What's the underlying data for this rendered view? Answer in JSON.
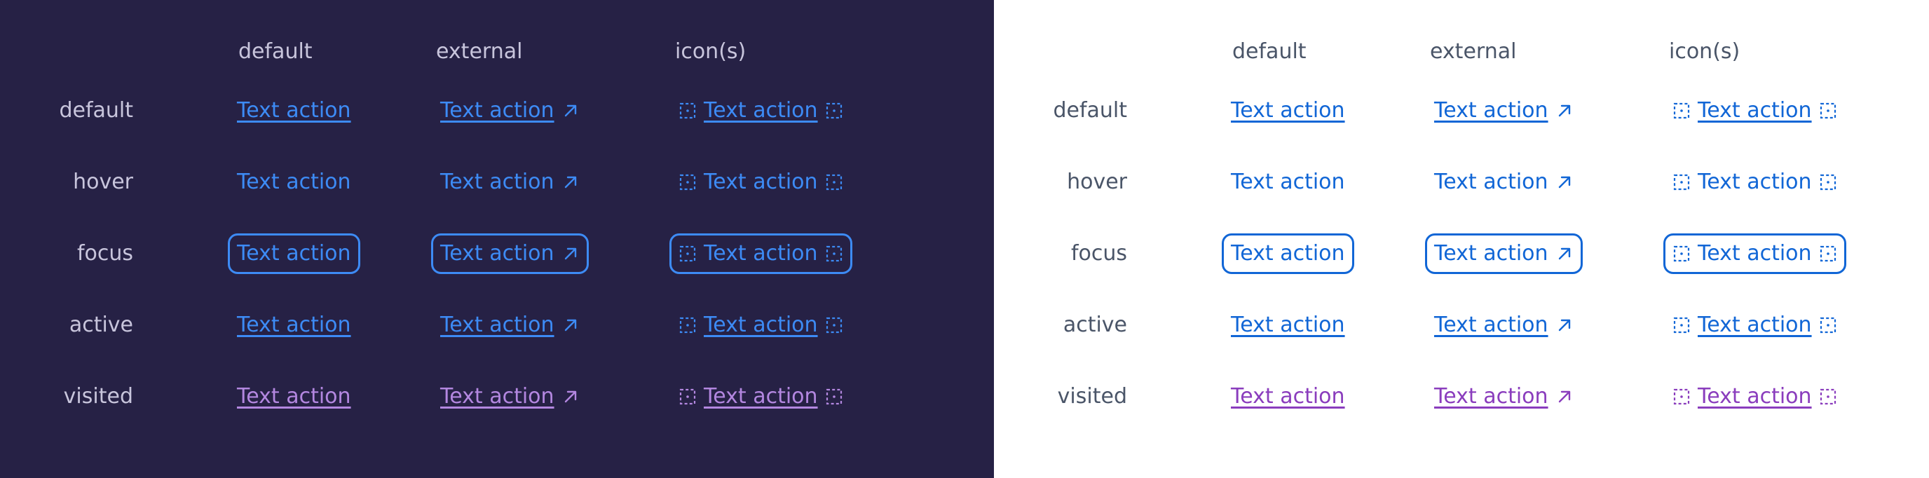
{
  "columns": [
    "default",
    "external",
    "icon(s)"
  ],
  "rows": [
    "default",
    "hover",
    "focus",
    "active",
    "visited"
  ],
  "link_text": "Text action",
  "themes": {
    "dark": {
      "background": "#262145",
      "link": "#3d8bf5",
      "visited": "#b387e0",
      "label": "#c8c5dc"
    },
    "light": {
      "background": "#ffffff",
      "link": "#1166d6",
      "visited": "#8a3dbd",
      "label": "#4a5568"
    }
  },
  "icons": {
    "external": "arrow-up-right-icon",
    "placeholder": "dashed-square-icon"
  }
}
